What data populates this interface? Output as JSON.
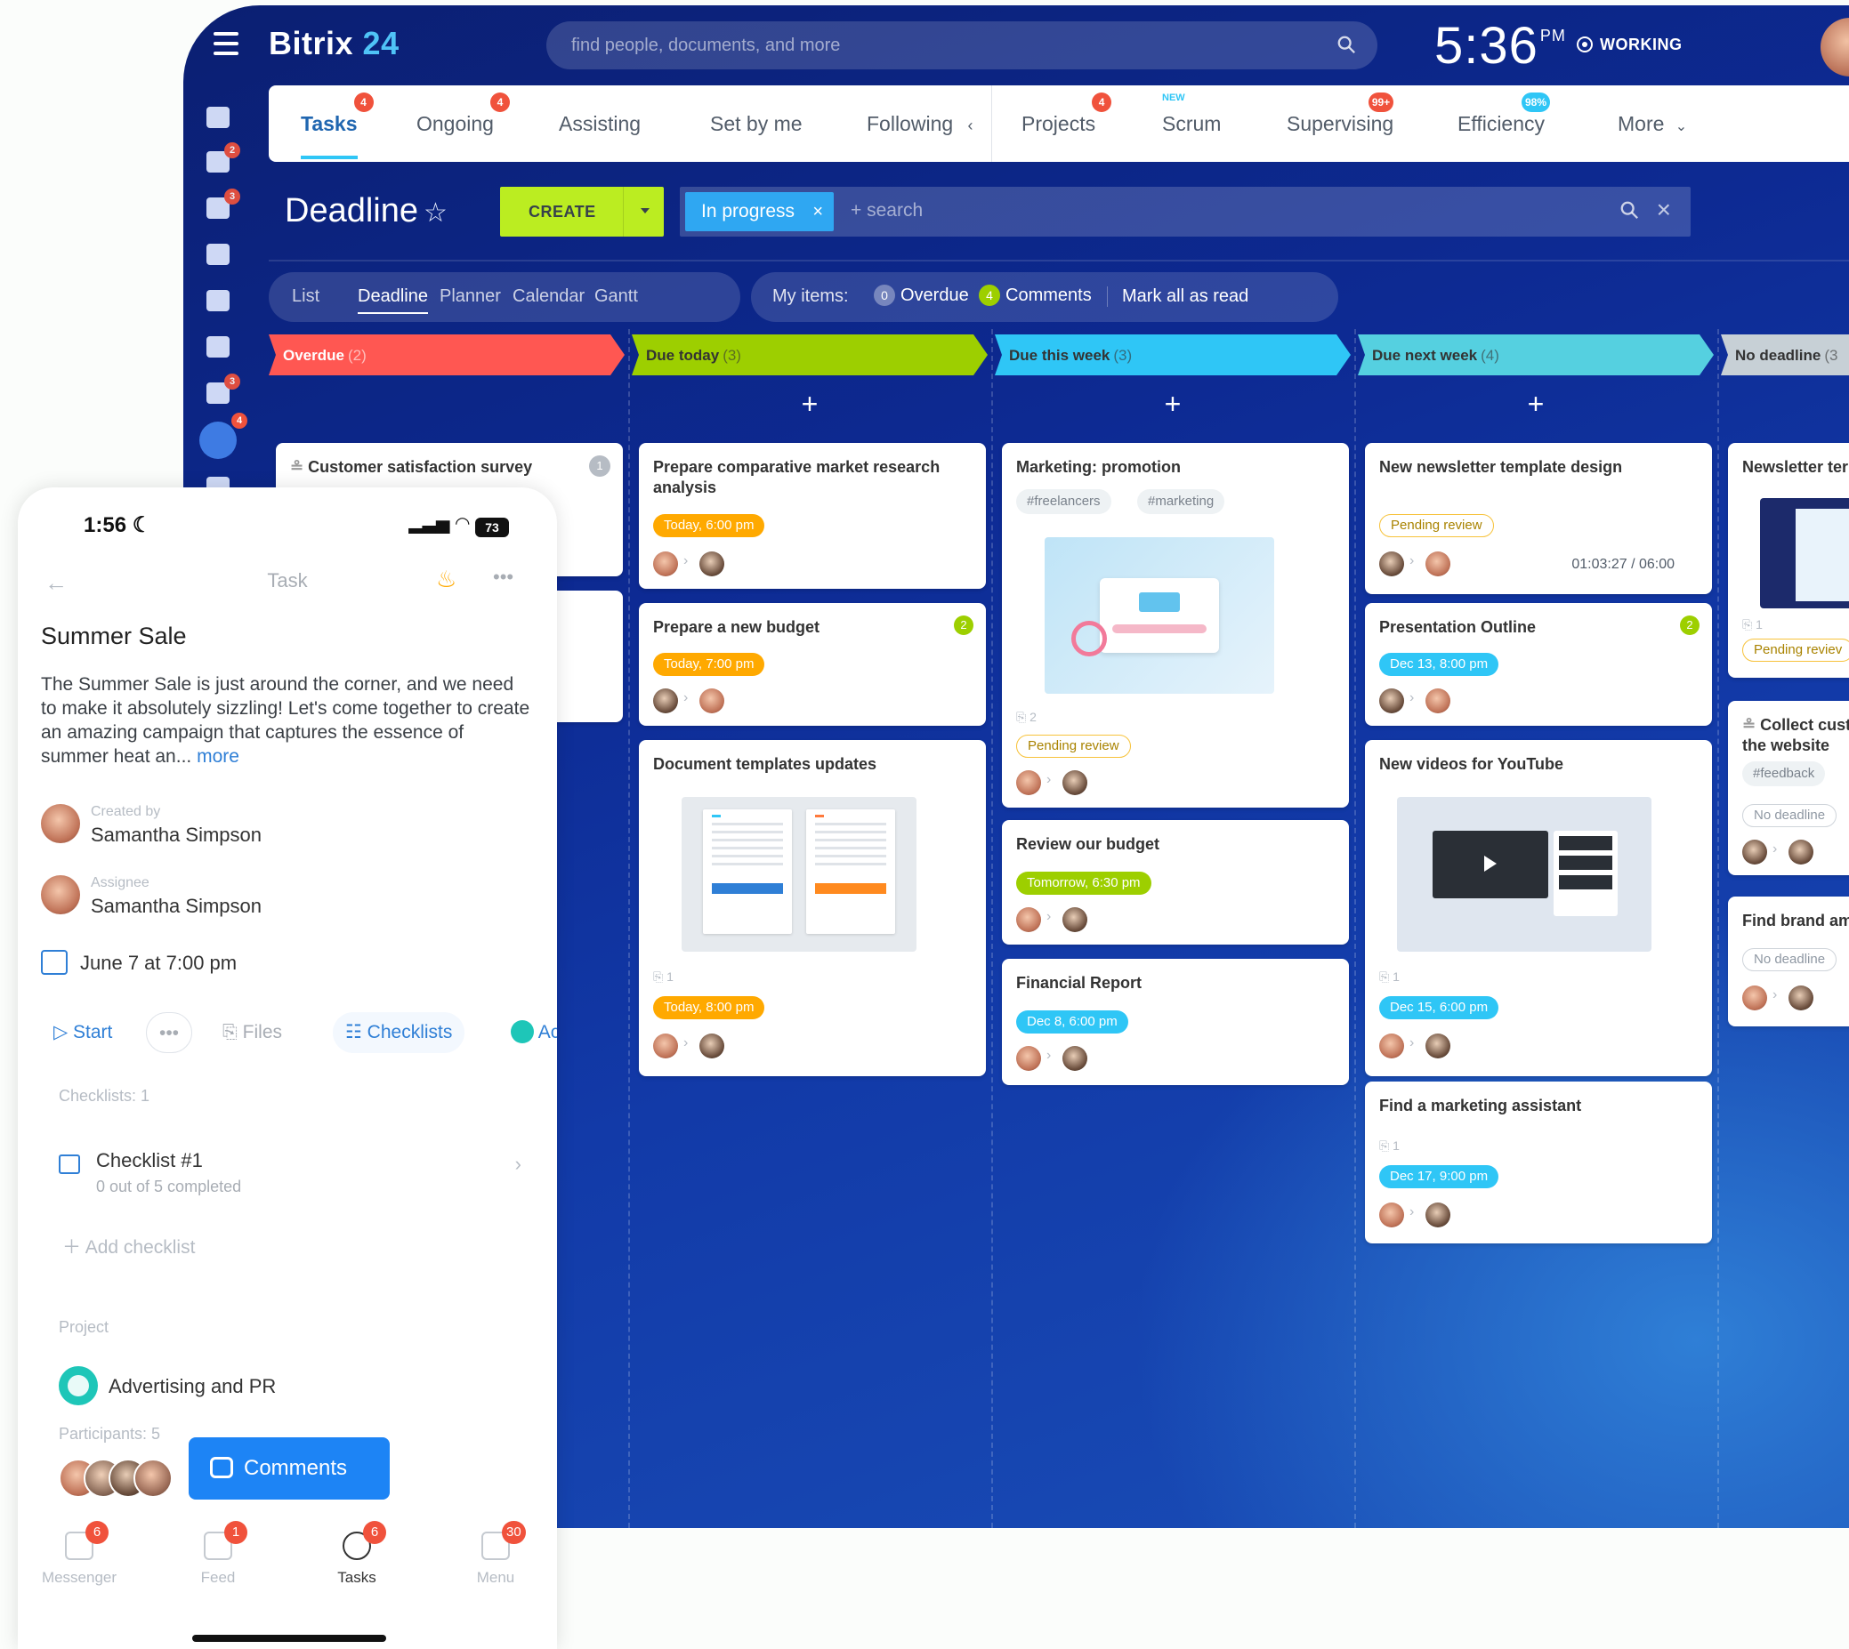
{
  "app": {
    "name": "Bitrix",
    "name_num": "24"
  },
  "search": {
    "placeholder": "find people, documents, and more"
  },
  "clock": {
    "time": "5:36",
    "ampm": "PM",
    "status": "WORKING"
  },
  "rail_badges": [
    "2",
    "3",
    "3",
    "4"
  ],
  "tabs": [
    {
      "label": "Tasks",
      "badge": "4"
    },
    {
      "label": "Ongoing",
      "badge": "4"
    },
    {
      "label": "Assisting",
      "badge": ""
    },
    {
      "label": "Set by me",
      "badge": ""
    },
    {
      "label": "Following",
      "badge": ""
    },
    {
      "label": "Projects",
      "badge": "4"
    },
    {
      "label": "Scrum",
      "badge": "",
      "new": "NEW"
    },
    {
      "label": "Supervising",
      "badge": "99+"
    },
    {
      "label": "Efficiency",
      "badge": "98%"
    },
    {
      "label": "More",
      "badge": ""
    }
  ],
  "page": {
    "title": "Deadline",
    "create": "CREATE",
    "filter_chip": "In progress",
    "filter_placeholder": "+ search"
  },
  "views": [
    "List",
    "Deadline",
    "Planner",
    "Calendar",
    "Gantt"
  ],
  "my_items": {
    "label": "My items:",
    "overdue_count": "0",
    "overdue": "Overdue",
    "comments_count": "4",
    "comments": "Comments",
    "mark_read": "Mark all as read"
  },
  "columns": [
    {
      "title": "Overdue",
      "count": "(2)",
      "color": "#ff5752"
    },
    {
      "title": "Due today",
      "count": "(3)",
      "color": "#9dcf00"
    },
    {
      "title": "Due this week",
      "count": "(3)",
      "color": "#2fc6f6"
    },
    {
      "title": "Due next week",
      "count": "(4)",
      "color": "#55d0e0"
    },
    {
      "title": "No deadline",
      "count": "(3",
      "color": "#c7d0d6"
    }
  ],
  "cards": {
    "c0a": {
      "title": "Customer satisfaction survey",
      "badge": "1"
    },
    "c1a": {
      "title": "Prepare comparative market research analysis",
      "deadline": "Today, 6:00 pm"
    },
    "c1b": {
      "title": "Prepare a new budget",
      "deadline": "Today, 7:00 pm",
      "badge": "2"
    },
    "c1c": {
      "title": "Document templates updates",
      "attach": "1",
      "deadline": "Today, 8:00 pm"
    },
    "c2a": {
      "title": "Marketing: promotion",
      "tag1": "#freelancers",
      "tag2": "#marketing",
      "attach": "2",
      "status": "Pending review"
    },
    "c2b": {
      "title": "Review our budget",
      "deadline": "Tomorrow, 6:30 pm"
    },
    "c2c": {
      "title": "Financial Report",
      "deadline": "Dec 8, 6:00 pm"
    },
    "c3a": {
      "title": "New newsletter template design",
      "status": "Pending review",
      "timer": "01:03:27 / 06:00"
    },
    "c3b": {
      "title": "Presentation Outline",
      "deadline": "Dec 13, 8:00 pm",
      "badge": "2"
    },
    "c3c": {
      "title": "New videos for YouTube",
      "attach": "1",
      "deadline": "Dec 15, 6:00 pm"
    },
    "c3d": {
      "title": "Find a marketing assistant",
      "attach": "1",
      "deadline": "Dec 17, 9:00 pm"
    },
    "c4a": {
      "title": "Newsletter ter",
      "attach": "1",
      "status": "Pending reviev"
    },
    "c4b": {
      "title": "Collect cust on the website",
      "tag": "#feedback",
      "status": "No deadline"
    },
    "c4c": {
      "title": "Find brand am",
      "status": "No deadline"
    }
  },
  "phone": {
    "time": "1:56",
    "battery": "73",
    "header": "Task",
    "title": "Summer Sale",
    "description": "The Summer Sale is just around the corner, and we need to make it absolutely sizzling! Let's come together to create an amazing campaign that captures the essence of summer heat an...",
    "more": "more",
    "created_label": "Created by",
    "created_value": "Samantha Simpson",
    "assignee_label": "Assignee",
    "assignee_value": "Samantha Simpson",
    "date": "June 7 at 7:00 pm",
    "actions": {
      "start": "Start",
      "files": "Files",
      "checklists": "Checklists",
      "ac": "Ac"
    },
    "checklists_label": "Checklists: 1",
    "checklist_title": "Checklist #1",
    "checklist_sub": "0 out of 5 completed",
    "add_checklist": "Add checklist",
    "project_label": "Project",
    "project_value": "Advertising and PR",
    "participants_label": "Participants: 5",
    "comments_button": "Comments",
    "nav": [
      {
        "label": "Messenger",
        "badge": "6"
      },
      {
        "label": "Feed",
        "badge": "1"
      },
      {
        "label": "Tasks",
        "badge": "6"
      },
      {
        "label": "Menu",
        "badge": "30"
      }
    ]
  }
}
